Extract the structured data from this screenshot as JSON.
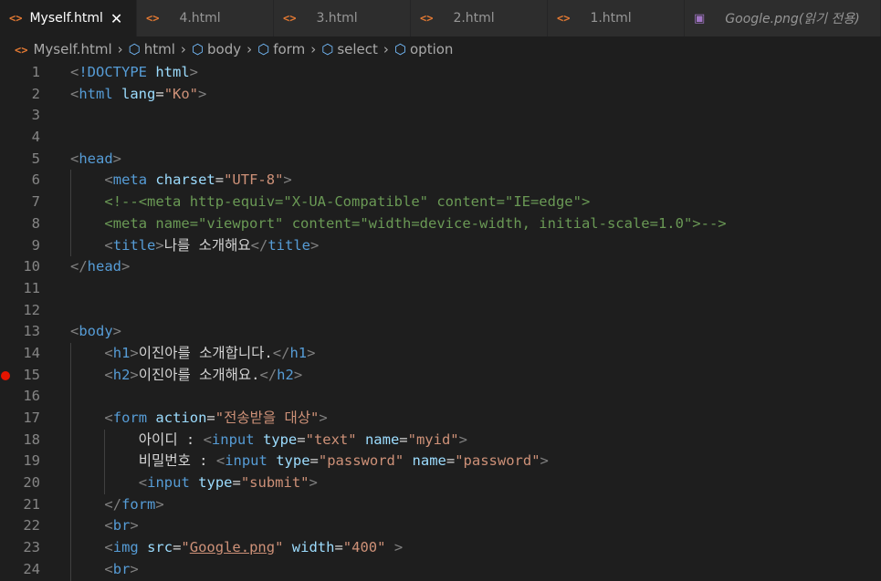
{
  "tabs": [
    {
      "label": "Myself.html",
      "active": true,
      "close": "✕"
    },
    {
      "label": "4.html"
    },
    {
      "label": "3.html"
    },
    {
      "label": "2.html"
    },
    {
      "label": "1.html"
    },
    {
      "label": "Google.png(읽기 전용)",
      "image": true
    }
  ],
  "breadcrumb": [
    "Myself.html",
    "html",
    "body",
    "form",
    "select",
    "option"
  ],
  "colors": {
    "tag": "#569cd6",
    "attr": "#9cdcfe",
    "string": "#ce9178",
    "comment": "#6a9955",
    "punct": "#808080",
    "text": "#d4d4d4",
    "breakpoint": "#e51400"
  },
  "lines": [
    {
      "n": "1",
      "indent": 0,
      "segs": [
        [
          "p",
          "<"
        ],
        [
          "t",
          "!DOCTYPE"
        ],
        [
          "x",
          " "
        ],
        [
          "a",
          "html"
        ],
        [
          "p",
          ">"
        ]
      ]
    },
    {
      "n": "2",
      "indent": 0,
      "segs": [
        [
          "p",
          "<"
        ],
        [
          "t",
          "html"
        ],
        [
          "x",
          " "
        ],
        [
          "a",
          "lang"
        ],
        [
          "x",
          "="
        ],
        [
          "s",
          "\"Ko\""
        ],
        [
          "p",
          ">"
        ]
      ]
    },
    {
      "n": "3",
      "indent": 0,
      "segs": []
    },
    {
      "n": "4",
      "indent": 0,
      "segs": []
    },
    {
      "n": "5",
      "indent": 0,
      "segs": [
        [
          "p",
          "<"
        ],
        [
          "t",
          "head"
        ],
        [
          "p",
          ">"
        ]
      ]
    },
    {
      "n": "6",
      "indent": 1,
      "segs": [
        [
          "p",
          "<"
        ],
        [
          "t",
          "meta"
        ],
        [
          "x",
          " "
        ],
        [
          "a",
          "charset"
        ],
        [
          "x",
          "="
        ],
        [
          "s",
          "\"UTF-8\""
        ],
        [
          "p",
          ">"
        ]
      ]
    },
    {
      "n": "7",
      "indent": 1,
      "segs": [
        [
          "c",
          "<!--<meta http-equiv=\"X-UA-Compatible\" content=\"IE=edge\">"
        ]
      ]
    },
    {
      "n": "8",
      "indent": 1,
      "segs": [
        [
          "c",
          "<meta name=\"viewport\" content=\"width=device-width, initial-scale=1.0\">-->"
        ]
      ]
    },
    {
      "n": "9",
      "indent": 1,
      "segs": [
        [
          "p",
          "<"
        ],
        [
          "t",
          "title"
        ],
        [
          "p",
          ">"
        ],
        [
          "x",
          "나를 소개해요"
        ],
        [
          "p",
          "</"
        ],
        [
          "t",
          "title"
        ],
        [
          "p",
          ">"
        ]
      ]
    },
    {
      "n": "10",
      "indent": 0,
      "segs": [
        [
          "p",
          "</"
        ],
        [
          "t",
          "head"
        ],
        [
          "p",
          ">"
        ]
      ]
    },
    {
      "n": "11",
      "indent": 0,
      "segs": []
    },
    {
      "n": "12",
      "indent": 0,
      "segs": []
    },
    {
      "n": "13",
      "indent": 0,
      "segs": [
        [
          "p",
          "<"
        ],
        [
          "t",
          "body"
        ],
        [
          "p",
          ">"
        ]
      ]
    },
    {
      "n": "14",
      "indent": 1,
      "segs": [
        [
          "p",
          "<"
        ],
        [
          "t",
          "h1"
        ],
        [
          "p",
          ">"
        ],
        [
          "x",
          "이진아를 소개합니다."
        ],
        [
          "p",
          "</"
        ],
        [
          "t",
          "h1"
        ],
        [
          "p",
          ">"
        ]
      ]
    },
    {
      "n": "15",
      "indent": 1,
      "bp": true,
      "segs": [
        [
          "p",
          "<"
        ],
        [
          "t",
          "h2"
        ],
        [
          "p",
          ">"
        ],
        [
          "x",
          "이진아를 소개해요."
        ],
        [
          "p",
          "</"
        ],
        [
          "t",
          "h2"
        ],
        [
          "p",
          ">"
        ]
      ]
    },
    {
      "n": "16",
      "indent": 1,
      "segs": []
    },
    {
      "n": "17",
      "indent": 1,
      "segs": [
        [
          "p",
          "<"
        ],
        [
          "t",
          "form"
        ],
        [
          "x",
          " "
        ],
        [
          "a",
          "action"
        ],
        [
          "x",
          "="
        ],
        [
          "s",
          "\"전송받을 대상\""
        ],
        [
          "p",
          ">"
        ]
      ]
    },
    {
      "n": "18",
      "indent": 2,
      "segs": [
        [
          "x",
          "아이디 : "
        ],
        [
          "p",
          "<"
        ],
        [
          "t",
          "input"
        ],
        [
          "x",
          " "
        ],
        [
          "a",
          "type"
        ],
        [
          "x",
          "="
        ],
        [
          "s",
          "\"text\""
        ],
        [
          "x",
          " "
        ],
        [
          "a",
          "name"
        ],
        [
          "x",
          "="
        ],
        [
          "s",
          "\"myid\""
        ],
        [
          "p",
          ">"
        ]
      ]
    },
    {
      "n": "19",
      "indent": 2,
      "segs": [
        [
          "x",
          "비밀번호 : "
        ],
        [
          "p",
          "<"
        ],
        [
          "t",
          "input"
        ],
        [
          "x",
          " "
        ],
        [
          "a",
          "type"
        ],
        [
          "x",
          "="
        ],
        [
          "s",
          "\"password\""
        ],
        [
          "x",
          " "
        ],
        [
          "a",
          "name"
        ],
        [
          "x",
          "="
        ],
        [
          "s",
          "\"password\""
        ],
        [
          "p",
          ">"
        ]
      ]
    },
    {
      "n": "20",
      "indent": 2,
      "segs": [
        [
          "p",
          "<"
        ],
        [
          "t",
          "input"
        ],
        [
          "x",
          " "
        ],
        [
          "a",
          "type"
        ],
        [
          "x",
          "="
        ],
        [
          "s",
          "\"submit\""
        ],
        [
          "p",
          ">"
        ]
      ]
    },
    {
      "n": "21",
      "indent": 1,
      "segs": [
        [
          "p",
          "</"
        ],
        [
          "t",
          "form"
        ],
        [
          "p",
          ">"
        ]
      ]
    },
    {
      "n": "22",
      "indent": 1,
      "segs": [
        [
          "p",
          "<"
        ],
        [
          "t",
          "br"
        ],
        [
          "p",
          ">"
        ]
      ]
    },
    {
      "n": "23",
      "indent": 1,
      "segs": [
        [
          "p",
          "<"
        ],
        [
          "t",
          "img"
        ],
        [
          "x",
          " "
        ],
        [
          "a",
          "src"
        ],
        [
          "x",
          "="
        ],
        [
          "s",
          "\""
        ],
        [
          "su",
          "Google.png"
        ],
        [
          "s",
          "\""
        ],
        [
          "x",
          " "
        ],
        [
          "a",
          "width"
        ],
        [
          "x",
          "="
        ],
        [
          "s",
          "\"400\""
        ],
        [
          "x",
          " "
        ],
        [
          "p",
          ">"
        ]
      ]
    },
    {
      "n": "24",
      "indent": 1,
      "segs": [
        [
          "p",
          "<"
        ],
        [
          "t",
          "br"
        ],
        [
          "p",
          ">"
        ]
      ]
    }
  ]
}
